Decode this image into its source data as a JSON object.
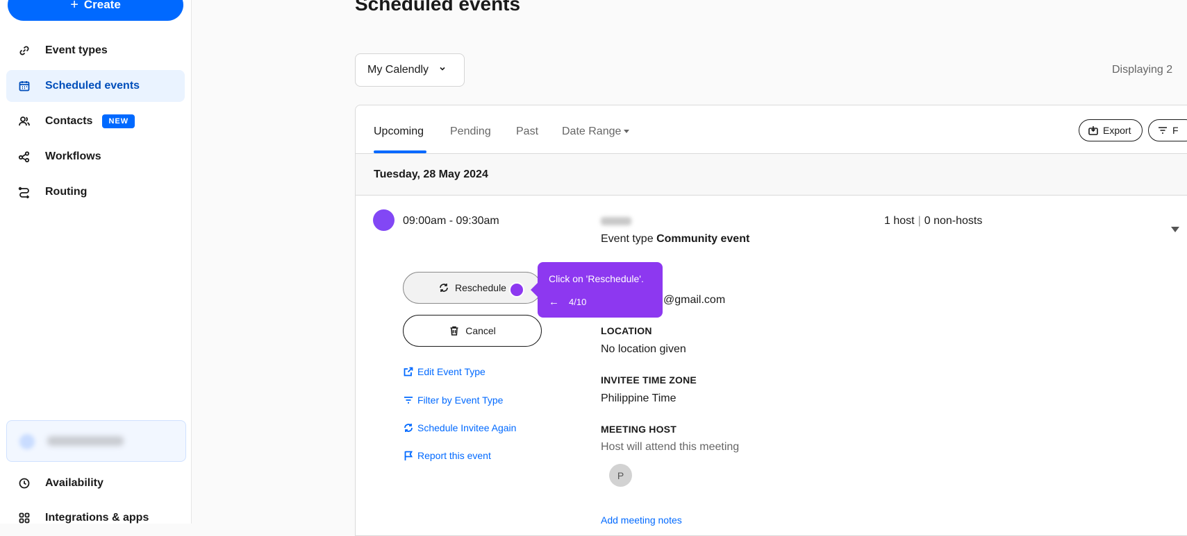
{
  "sidebar": {
    "create_label": "Create",
    "items": [
      {
        "label": "Event types",
        "icon": "link-icon"
      },
      {
        "label": "Scheduled events",
        "icon": "calendar-icon"
      },
      {
        "label": "Contacts",
        "icon": "contacts-icon",
        "badge": "NEW"
      },
      {
        "label": "Workflows",
        "icon": "workflows-icon"
      },
      {
        "label": "Routing",
        "icon": "routing-icon"
      },
      {
        "label": "Availability",
        "icon": "clock-icon"
      },
      {
        "label": "Integrations & apps",
        "icon": "grid-icon"
      }
    ],
    "active_item": "Scheduled events"
  },
  "header": {
    "title": "Scheduled events",
    "calendar_select": "My Calendly",
    "displaying": "Displaying 2"
  },
  "tabs": [
    {
      "label": "Upcoming",
      "active": true
    },
    {
      "label": "Pending"
    },
    {
      "label": "Past"
    },
    {
      "label": "Date Range"
    }
  ],
  "toolbar": {
    "export_label": "Export",
    "filter_label": "F"
  },
  "event": {
    "date_heading": "Tuesday, 28 May 2024",
    "time": "09:00am - 09:30am",
    "event_type_prefix": "Event type",
    "event_type_name": "Community event",
    "hosts": "1 host",
    "non_hosts": "0 non-hosts",
    "reschedule_label": "Reschedule",
    "cancel_label": "Cancel",
    "links": [
      "Edit Event Type",
      "Filter by Event Type",
      "Schedule Invitee Again",
      "Report this event"
    ],
    "email_partial": "@gmail.com",
    "location_label": "LOCATION",
    "location_value": "No location given",
    "timezone_label": "INVITEE TIME ZONE",
    "timezone_value": "Philippine Time",
    "host_label": "MEETING HOST",
    "host_note": "Host will attend this meeting",
    "host_avatar": "P",
    "add_notes": "Add meeting notes"
  },
  "tooltip": {
    "message": "Click on 'Reschedule'.",
    "step": "4/10"
  },
  "colors": {
    "primary": "#0069ff",
    "tooltip": "#8d38f0",
    "event_dot": "#8247f5"
  }
}
